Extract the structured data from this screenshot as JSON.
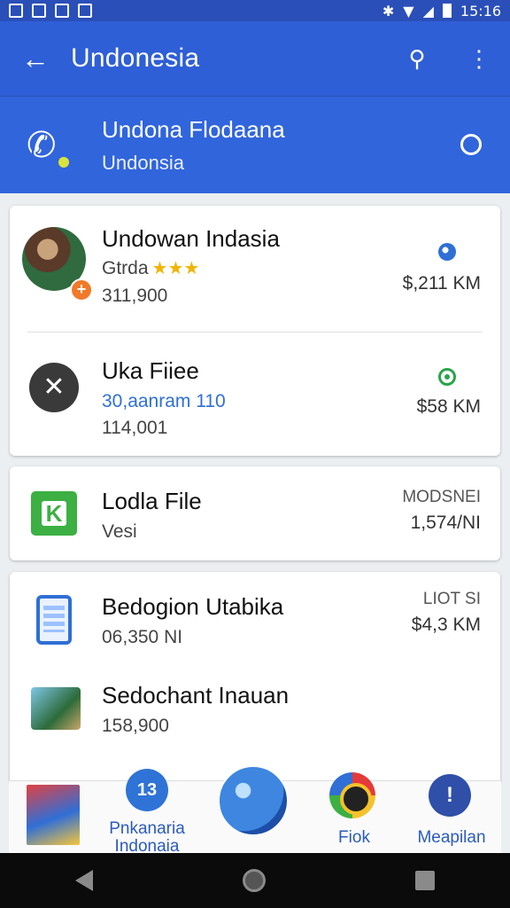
{
  "status_bar": {
    "time": "15:16"
  },
  "app_bar": {
    "title": "Undonesia"
  },
  "sub_header": {
    "title": "Undona Flodaana",
    "subtitle": "Undonsia"
  },
  "cards": [
    {
      "items": [
        {
          "title": "Undowan Indasia",
          "line1": "Gtrda",
          "stars": "★★★",
          "line2": "311,900",
          "right": "$,211 KM"
        },
        {
          "title": "Uka Fiiee",
          "line1": "30,aanram 110",
          "line2": "114,001",
          "right": "$58 KM"
        }
      ]
    },
    {
      "items": [
        {
          "title": "Lodla File",
          "line1": "Vesi",
          "right_top": "MODSNEI",
          "right": "1,574/NI"
        }
      ]
    },
    {
      "items": [
        {
          "title": "Bedogion Utabika",
          "line1": "06,350 NI",
          "right_top": "LIOT SI",
          "right": "$4,3 KM"
        },
        {
          "title": "Sedochant Inauan",
          "line1": "158,900"
        }
      ]
    }
  ],
  "dock": [
    {
      "icon": "book-icon",
      "label": ""
    },
    {
      "icon": "chat-icon",
      "label": "Pnkanaria Indonaia"
    },
    {
      "icon": "globe-icon",
      "label": ""
    },
    {
      "icon": "camera-icon",
      "label": "Fiok"
    },
    {
      "icon": "info-icon",
      "label": "Meapilan"
    }
  ],
  "colors": {
    "primary": "#2f5fd6",
    "accent_green": "#3cb043",
    "star": "#f0b400"
  }
}
